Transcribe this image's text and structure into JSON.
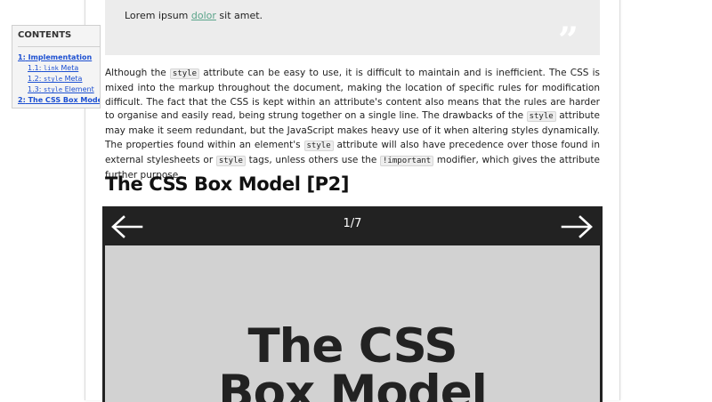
{
  "toc": {
    "title": "CONTENTS",
    "items": [
      {
        "num": "1:",
        "label": "Implementation"
      },
      {
        "num": "1.1:",
        "code": "link",
        "label": "Meta"
      },
      {
        "num": "1.2:",
        "code": "style",
        "label": "Meta"
      },
      {
        "num": "1.3:",
        "code": "style",
        "label": "Element"
      },
      {
        "num": "2:",
        "label": "The CSS Box Model"
      }
    ]
  },
  "quote": {
    "text_before": "Lorem ipsum ",
    "text_highlight": "dolor",
    "text_after": " sit amet.",
    "mark": "”"
  },
  "paragraph": {
    "p1": "Although the ",
    "c1": "style",
    "p2": " attribute can be easy to use, it is difficult to maintain and is inefficient. The CSS is mixed into the markup throughout the document, making the location of specific rules for modification difficult. The fact that the CSS is kept within an attribute's content also means that the rules are harder to organise and easily read, being strung together on a single line. The drawbacks of the ",
    "c2": "style",
    "p3": " attribute may make it seem redundant, but the JavaScript makes heavy use of it when altering styles dynamically. The properties found within an element's ",
    "c3": "style",
    "p4": " attribute will also have precedence over those found in external stylesheets or ",
    "c4": "style",
    "p5": " tags, unless others use the ",
    "c5": "!important",
    "p6": " modifier, which gives the attribute further purpose."
  },
  "section": {
    "heading": "The CSS Box Model [P2]"
  },
  "slideshow": {
    "counter": "1/7",
    "prev_icon": "arrow-left-icon",
    "next_icon": "arrow-right-icon",
    "slide_title_line1": "The CSS",
    "slide_title_line2": "Box Model"
  },
  "colors": {
    "link": "#1c4fd1",
    "highlight": "#5aa48a",
    "slide_bar": "#222222",
    "slide_bg": "#d2d2d2"
  }
}
